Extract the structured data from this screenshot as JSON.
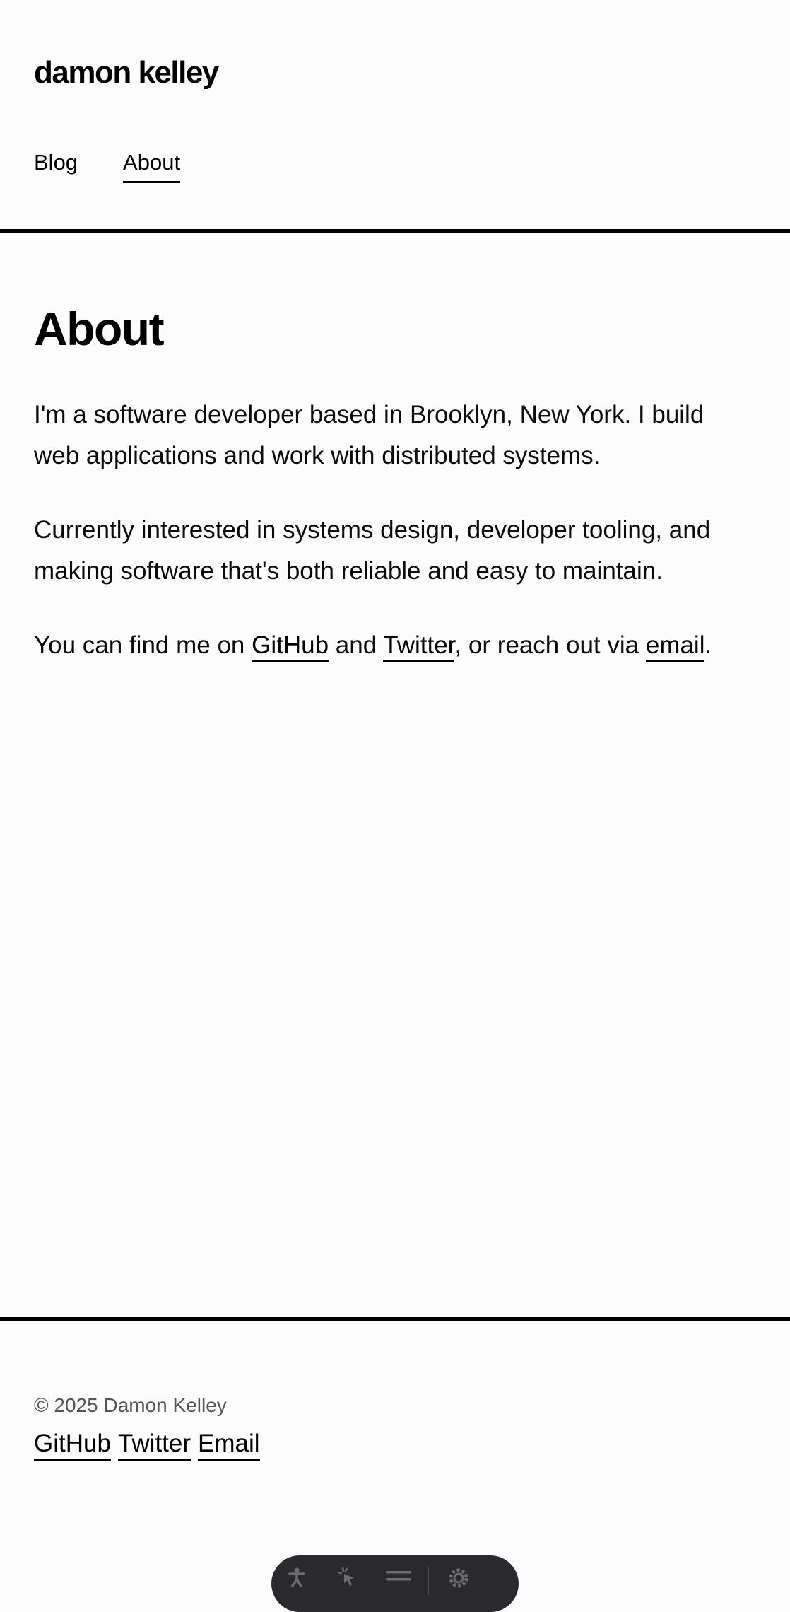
{
  "header": {
    "site_title": "damon kelley",
    "nav": [
      {
        "label": "Blog",
        "active": false
      },
      {
        "label": "About",
        "active": true
      }
    ]
  },
  "main": {
    "heading": "About",
    "paragraph1": "I'm a software developer based in Brooklyn, New York. I build web applications and work with distributed systems.",
    "paragraph2": "Currently interested in systems design, developer tooling, and making software that's both reliable and easy to maintain.",
    "paragraph3": {
      "prefix": "You can find me on ",
      "github_label": "GitHub",
      "and": " and ",
      "twitter_label": "Twitter",
      "middle": ", or reach out via ",
      "email_label": "email",
      "suffix": "."
    }
  },
  "footer": {
    "copyright": "© 2025 Damon Kelley",
    "links": [
      {
        "label": "GitHub"
      },
      {
        "label": "Twitter"
      },
      {
        "label": "Email"
      }
    ]
  },
  "toolbar": {
    "icons": [
      "accessibility-icon",
      "cursor-click-icon",
      "menu-icon",
      "gear-icon"
    ]
  },
  "colors": {
    "background": "#fdfcfc",
    "text": "#000000",
    "muted": "#555555",
    "toolbar": "#2a2a2e"
  }
}
